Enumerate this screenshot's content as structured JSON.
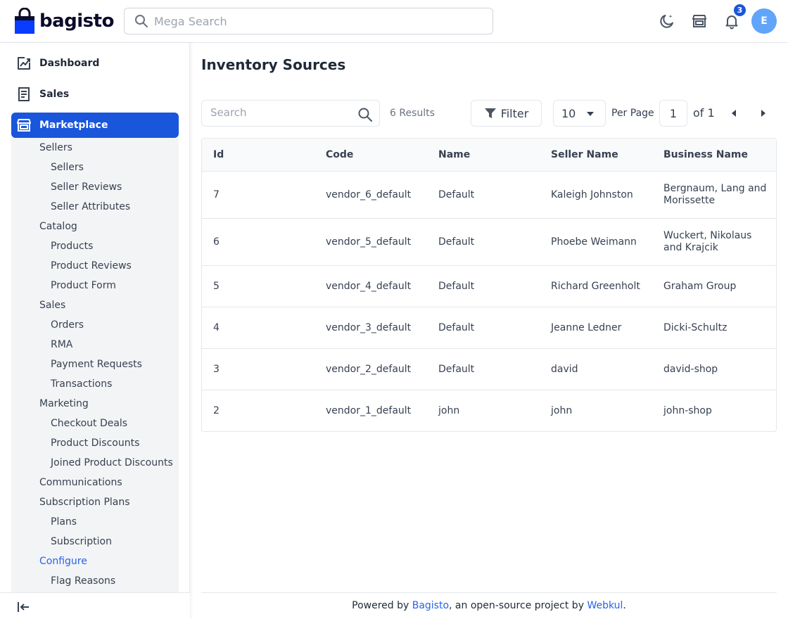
{
  "header": {
    "logo_text": "bagisto",
    "search_placeholder": "Mega Search",
    "notification_count": "3",
    "avatar_initial": "E"
  },
  "sidebar": {
    "top_items": [
      {
        "label": "Dashboard",
        "icon": "dashboard-icon"
      },
      {
        "label": "Sales",
        "icon": "sales-icon"
      },
      {
        "label": "Marketplace",
        "icon": "marketplace-icon",
        "active": true
      }
    ],
    "submenu": [
      {
        "label": "Sellers",
        "level": 1
      },
      {
        "label": "Sellers",
        "level": 2
      },
      {
        "label": "Seller Reviews",
        "level": 2
      },
      {
        "label": "Seller Attributes",
        "level": 2
      },
      {
        "label": "Catalog",
        "level": 1
      },
      {
        "label": "Products",
        "level": 2
      },
      {
        "label": "Product Reviews",
        "level": 2
      },
      {
        "label": "Product Form",
        "level": 2
      },
      {
        "label": "Sales",
        "level": 1
      },
      {
        "label": "Orders",
        "level": 2
      },
      {
        "label": "RMA",
        "level": 2
      },
      {
        "label": "Payment Requests",
        "level": 2
      },
      {
        "label": "Transactions",
        "level": 2
      },
      {
        "label": "Marketing",
        "level": 1
      },
      {
        "label": "Checkout Deals",
        "level": 2
      },
      {
        "label": "Product Discounts",
        "level": 2
      },
      {
        "label": "Joined Product Discounts",
        "level": 2
      },
      {
        "label": "Communications",
        "level": 1
      },
      {
        "label": "Subscription Plans",
        "level": 1
      },
      {
        "label": "Plans",
        "level": 2
      },
      {
        "label": "Subscription",
        "level": 2
      },
      {
        "label": "Configure",
        "level": 1,
        "current": true
      },
      {
        "label": "Flag Reasons",
        "level": 2
      }
    ]
  },
  "main": {
    "title": "Inventory Sources",
    "search_placeholder": "Search",
    "results": "6 Results",
    "filter_label": "Filter",
    "per_page_value": "10",
    "per_page_label": "Per Page",
    "page_value": "1",
    "page_of": "of 1"
  },
  "table": {
    "columns": [
      "Id",
      "Code",
      "Name",
      "Seller Name",
      "Business Name"
    ],
    "rows": [
      [
        "7",
        "vendor_6_default",
        "Default",
        "Kaleigh Johnston",
        "Bergnaum, Lang and Morissette"
      ],
      [
        "6",
        "vendor_5_default",
        "Default",
        "Phoebe Weimann",
        "Wuckert, Nikolaus and Krajcik"
      ],
      [
        "5",
        "vendor_4_default",
        "Default",
        "Richard Greenholt",
        "Graham Group"
      ],
      [
        "4",
        "vendor_3_default",
        "Default",
        "Jeanne Ledner",
        "Dicki-Schultz"
      ],
      [
        "3",
        "vendor_2_default",
        "Default",
        "david",
        "david-shop"
      ],
      [
        "2",
        "vendor_1_default",
        "john",
        "john",
        "john-shop"
      ]
    ]
  },
  "footer": {
    "prefix": "Powered by ",
    "link1": "Bagisto",
    "middle": ", an open-source project by ",
    "link2": "Webkul",
    "suffix": "."
  },
  "colors": {
    "accent": "#1a56db",
    "link": "#2563eb",
    "avatar": "#60a5fa",
    "submenu_bg": "#f3f4f6"
  }
}
